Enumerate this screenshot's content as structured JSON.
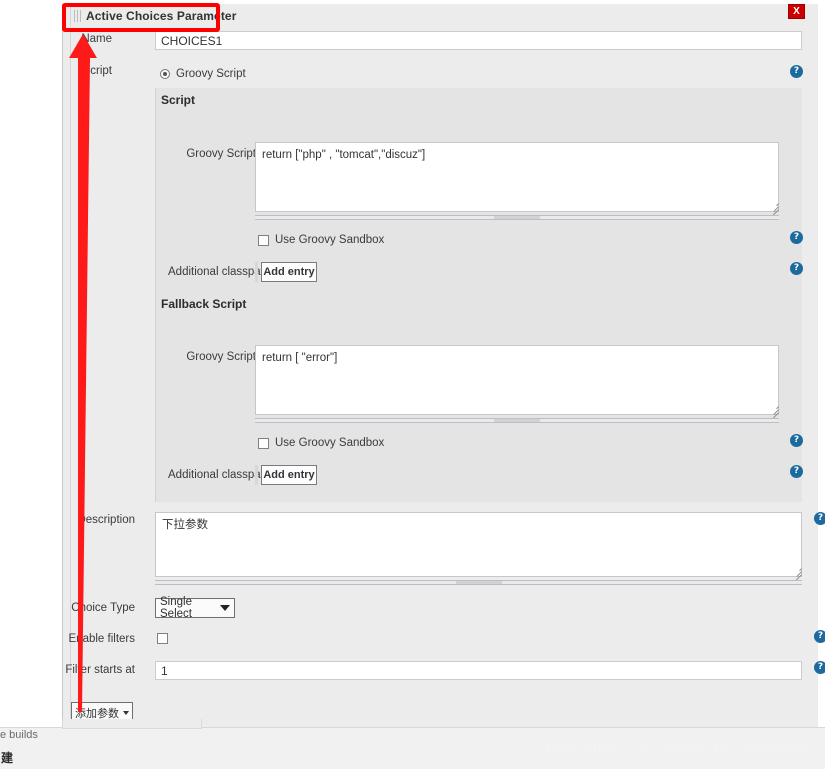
{
  "dialog": {
    "title": "Active Choices Parameter",
    "close_label": "X",
    "drag_handle_name": "drag-grip"
  },
  "fields": {
    "name": {
      "label": "Name",
      "value": "CHOICES1"
    },
    "script_section_label": "Script",
    "script_radio": {
      "label": "Groovy Script",
      "selected": true
    },
    "script_heading": "Script",
    "script_groovy": {
      "label": "Groovy Script",
      "value": "return [\"php\" , \"tomcat\",\"discuz\"]"
    },
    "script_sandbox": {
      "label": "Use Groovy Sandbox",
      "checked": false
    },
    "script_classpath": {
      "label": "Additional classpath",
      "button": "Add entry"
    },
    "fallback_heading": "Fallback Script",
    "fallback_groovy": {
      "label": "Groovy Script",
      "value": "return [ \"error\"]"
    },
    "fallback_sandbox": {
      "label": "Use Groovy Sandbox",
      "checked": false
    },
    "fallback_classpath": {
      "label": "Additional classpath",
      "button": "Add entry"
    },
    "description": {
      "label": "Description",
      "value": "下拉参数"
    },
    "choice_type": {
      "label": "Choice Type",
      "value": "Single Select"
    },
    "enable_filters": {
      "label": "Enable filters",
      "checked": false
    },
    "filter_starts_at": {
      "label": "Filter starts at",
      "value": "1"
    }
  },
  "buttons": {
    "add_parameter": "添加参数"
  },
  "help_icon": "?",
  "footer": {
    "text_a": "e builds",
    "text_b": "建"
  },
  "watermark": "https://blog.csdn.net/weixin_52492280",
  "colors": {
    "accent_help": "#1c6a9e",
    "close_red": "#cc0000",
    "annotation_red": "#ff0000",
    "panel_bg": "#ececec",
    "section_bg": "#e4e4e4"
  }
}
